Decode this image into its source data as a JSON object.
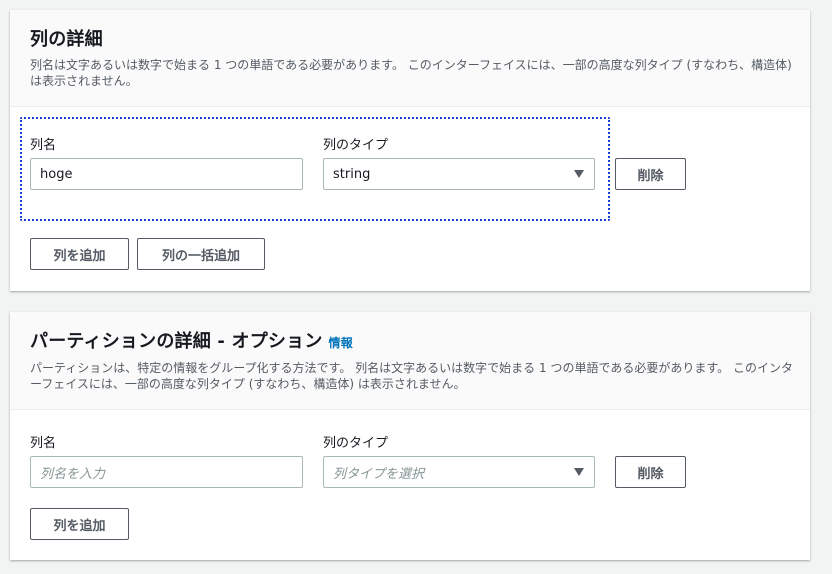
{
  "columns_panel": {
    "title": "列の詳細",
    "description": "列名は文字あるいは数字で始まる 1 つの単語である必要があります。 このインターフェイスには、一部の高度な列タイプ (すなわち、構造体) は表示されません。",
    "name_label": "列名",
    "type_label": "列のタイプ",
    "name_value": "hoge",
    "type_value": "string",
    "delete_label": "削除",
    "add_column_label": "列を追加",
    "bulk_add_label": "列の一括追加"
  },
  "partitions_panel": {
    "title": "パーティションの詳細 - オプション",
    "info_link": "情報",
    "description": "パーティションは、特定の情報をグループ化する方法です。 列名は文字あるいは数字で始まる 1 つの単語である必要があります。 このインターフェイスには、一部の高度な列タイプ (すなわち、構造体) は表示されません。",
    "name_label": "列名",
    "type_label": "列のタイプ",
    "name_placeholder": "列名を入力",
    "type_placeholder": "列タイプを選択",
    "delete_label": "削除",
    "add_column_label": "列を追加"
  },
  "colors": {
    "link": "#0073bb",
    "focus_outline": "#1a3fd6",
    "button_border": "#545b64"
  },
  "icons": {
    "select_caret": "caret-down-icon"
  }
}
